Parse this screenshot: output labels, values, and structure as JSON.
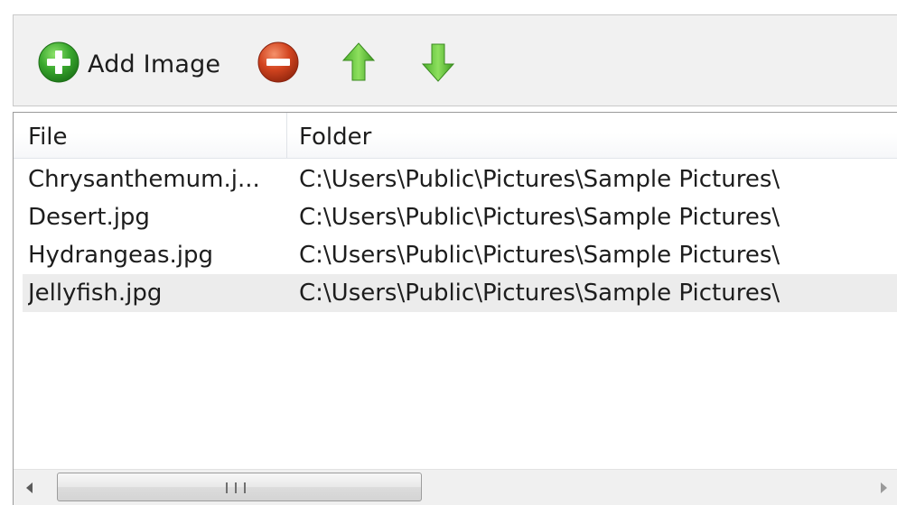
{
  "toolbar": {
    "add_label": "Add Image",
    "icons": {
      "add": "plus-circle-icon",
      "remove": "minus-circle-icon",
      "up": "arrow-up-icon",
      "down": "arrow-down-icon"
    }
  },
  "list": {
    "columns": [
      "File",
      "Folder"
    ],
    "rows": [
      {
        "file": "Chrysanthemum.j...",
        "folder": "C:\\Users\\Public\\Pictures\\Sample Pictures\\"
      },
      {
        "file": "Desert.jpg",
        "folder": "C:\\Users\\Public\\Pictures\\Sample Pictures\\"
      },
      {
        "file": "Hydrangeas.jpg",
        "folder": "C:\\Users\\Public\\Pictures\\Sample Pictures\\"
      },
      {
        "file": "Jellyfish.jpg",
        "folder": "C:\\Users\\Public\\Pictures\\Sample Pictures\\"
      }
    ],
    "selected_row": 3
  },
  "colors": {
    "add_green": "#3aa82e",
    "remove_red": "#c0392b",
    "arrow_green": "#5cc43a",
    "selection": "#ececec"
  }
}
